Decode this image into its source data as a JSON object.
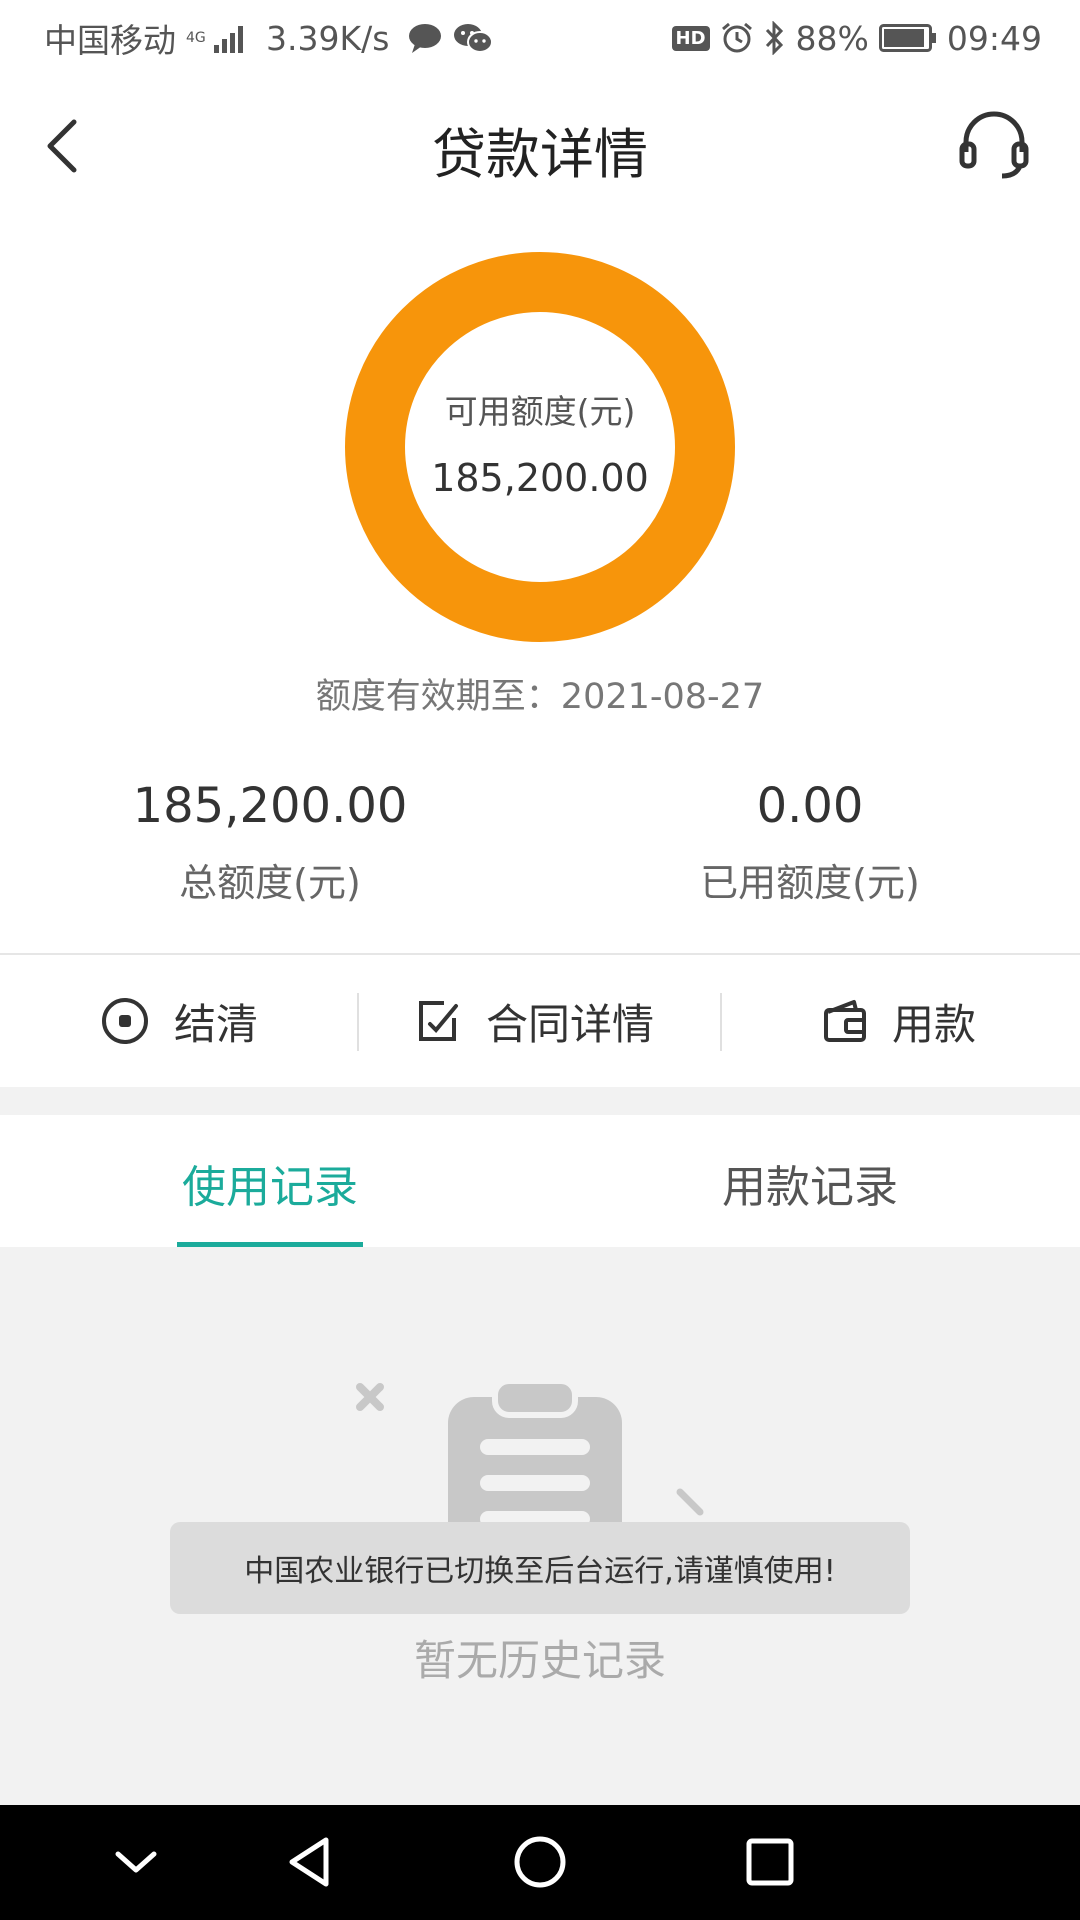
{
  "status_bar": {
    "carrier": "中国移动",
    "network": "4G",
    "speed": "3.39K/s",
    "hd": "HD",
    "battery": "88%",
    "time": "09:49"
  },
  "header": {
    "title": "贷款详情",
    "back_icon": "chevron-left-icon",
    "service_icon": "headset-icon"
  },
  "credit": {
    "available_label": "可用额度(元)",
    "available_value": "185,200.00",
    "available_fraction": 1.0,
    "validity": "额度有效期至：2021-08-27",
    "total_value": "185,200.00",
    "total_label": "总额度(元)",
    "used_value": "0.00",
    "used_label": "已用额度(元)"
  },
  "actions": [
    {
      "label": "结清",
      "icon": "radio-dot-icon"
    },
    {
      "label": "合同详情",
      "icon": "edit-document-icon"
    },
    {
      "label": "用款",
      "icon": "wallet-icon"
    }
  ],
  "tabs": [
    {
      "label": "使用记录",
      "active": true
    },
    {
      "label": "用款记录",
      "active": false
    }
  ],
  "empty": {
    "text": "暂无历史记录",
    "icon": "empty-clipboard-icon"
  },
  "toast": {
    "text": "中国农业银行已切换至后台运行,请谨慎使用!"
  },
  "colors": {
    "accent": "#1bab9b",
    "donut": "#f7950b",
    "background_gray": "#f2f2f2"
  }
}
